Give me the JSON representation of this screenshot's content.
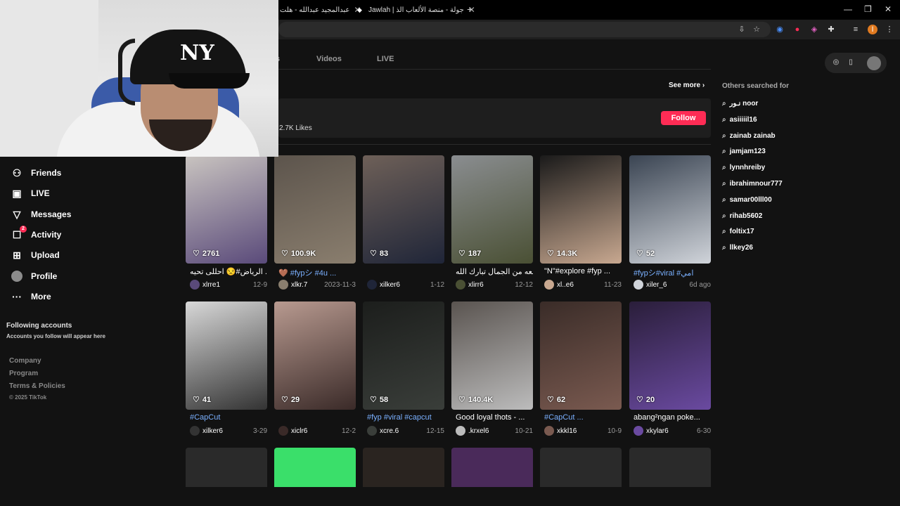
{
  "browser": {
    "tabs": [
      {
        "title": "عبدالمجيد عبدالله - هلت"
      },
      {
        "title": "Jawlah | جولة - منصة الألعاب الذ"
      }
    ],
    "new_tab": "+",
    "minimize": "—",
    "restore": "❐",
    "close": "✕",
    "tab_close": "✕"
  },
  "profile_tabs": {
    "partial": "s",
    "videos": "Videos",
    "live": "LIVE"
  },
  "accounts_section": {
    "see_more": "See more",
    "likes": "2.7K Likes",
    "follow": "Follow"
  },
  "sidebar": {
    "items": [
      {
        "label": "Friends",
        "icon": "friends-icon"
      },
      {
        "label": "LIVE",
        "icon": "live-icon"
      },
      {
        "label": "Messages",
        "icon": "messages-icon"
      },
      {
        "label": "Activity",
        "icon": "activity-icon",
        "badge": "2"
      },
      {
        "label": "Upload",
        "icon": "upload-icon"
      },
      {
        "label": "Profile",
        "icon": "profile-icon"
      },
      {
        "label": "More",
        "icon": "more-icon"
      }
    ],
    "following_title": "Following accounts",
    "following_sub": "Accounts you follow will appear here",
    "footer": [
      "Company",
      "Program",
      "Terms & Policies"
    ],
    "copyright": "© 2025 TikTok"
  },
  "others_searched": {
    "title": "Others searched for",
    "items": [
      "نـور noor",
      "asiiiiil16",
      "zainab zainab",
      "jamjam123",
      "lynnhreiby",
      "ibrahimnour777",
      "samar00lll00",
      "rihab5602",
      "foltix17",
      "llkey26"
    ]
  },
  "videos": [
    {
      "likes": "2761",
      "caption": "الرياض#😒 احللى تحيه ...",
      "tag": false,
      "user": "xlrre1",
      "date": "12-9",
      "bg": "#c9c4c0",
      "accent": "#5a4a7a"
    },
    {
      "likes": "100.9K",
      "caption": "🤎 #fypシ #4u ...",
      "tag": true,
      "user": "xlkr.7",
      "date": "2023-11-3",
      "bg": "#5c544c",
      "accent": "#8a7e6e"
    },
    {
      "likes": "83",
      "caption": "",
      "tag": false,
      "user": "xilker6",
      "date": "1-12",
      "bg": "#6e6058",
      "accent": "#1f2538"
    },
    {
      "likes": "187",
      "caption": "قطعه من الجمال تبارك الله",
      "tag": false,
      "user": "xlirr6",
      "date": "12-12",
      "bg": "#8a8d90",
      "accent": "#4a5034"
    },
    {
      "likes": "14.3K",
      "caption": "\"N\"#explore #fyp ...",
      "tag": false,
      "user": "xl..e6",
      "date": "11-23",
      "bg": "#1a1a1a",
      "accent": "#c8a890"
    },
    {
      "likes": "52",
      "caption": "#fypシ#viral #امي",
      "tag": true,
      "user": "xiler_6",
      "date": "6d ago",
      "bg": "#3a4452",
      "accent": "#d0d4da"
    },
    {
      "likes": "41",
      "caption": "#CapCut",
      "tag": true,
      "user": "xilker6",
      "date": "3-29",
      "bg": "#d8d8d8",
      "accent": "#333"
    },
    {
      "likes": "29",
      "caption": "",
      "tag": false,
      "user": "xiclr6",
      "date": "12-2",
      "bg": "#b89a90",
      "accent": "#3a2a28"
    },
    {
      "likes": "58",
      "caption": "#fyp #viral #capcut",
      "tag": true,
      "user": "xcre.6",
      "date": "12-15",
      "bg": "#1c1e1c",
      "accent": "#3a3e3a"
    },
    {
      "likes": "140.4K",
      "caption": "Good loyal thots - ...",
      "tag": false,
      "user": ".krxel6",
      "date": "10-21",
      "bg": "#5a5450",
      "accent": "#bcbcbc"
    },
    {
      "likes": "62",
      "caption": "#CapCut ...",
      "tag": true,
      "user": "xkkl16",
      "date": "10-9",
      "bg": "#3a2c28",
      "accent": "#7a5a50"
    },
    {
      "likes": "20",
      "caption": "abang²ngan poke...",
      "tag": false,
      "user": "xkylar6",
      "date": "6-30",
      "bg": "#2a1e3a",
      "accent": "#6a4aa0"
    }
  ],
  "row3_colors": [
    "#2a2a2a",
    "#3adf6a",
    "#2a2420",
    "#4a2a5a",
    "#2a2a2a",
    "#2a2a2a"
  ],
  "icons": {
    "heart": "♡",
    "search": "⌕",
    "chevron": "›",
    "star": "☆",
    "compass": "◎",
    "phone": "▯"
  },
  "colors": {
    "accent": "#fe2c55",
    "hashtag": "#7ab0ff"
  }
}
